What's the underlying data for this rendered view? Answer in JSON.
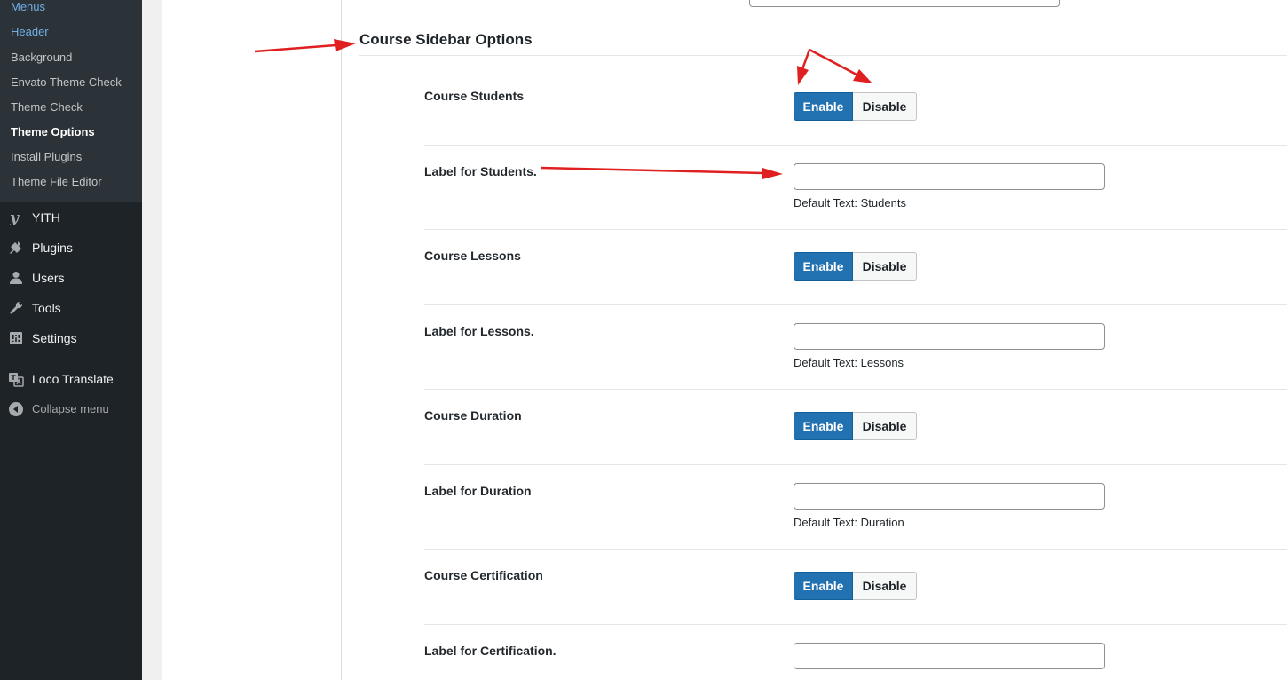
{
  "sidebar": {
    "submenu": [
      {
        "label": "Menus"
      },
      {
        "label": "Header"
      },
      {
        "label": "Background"
      },
      {
        "label": "Envato Theme Check"
      },
      {
        "label": "Theme Check"
      },
      {
        "label": "Theme Options"
      },
      {
        "label": "Install Plugins"
      },
      {
        "label": "Theme File Editor"
      }
    ],
    "menu": [
      {
        "label": "YITH",
        "icon": "yith-icon"
      },
      {
        "label": "Plugins",
        "icon": "plugins-icon"
      },
      {
        "label": "Users",
        "icon": "users-icon"
      },
      {
        "label": "Tools",
        "icon": "tools-icon"
      },
      {
        "label": "Settings",
        "icon": "settings-icon"
      },
      {
        "label": "Loco Translate",
        "icon": "translate-icon"
      },
      {
        "label": "Collapse menu",
        "icon": "collapse-icon"
      }
    ]
  },
  "section": {
    "title": "Course Sidebar Options"
  },
  "rows": [
    {
      "label": "Course Students",
      "type": "toggle",
      "on": "Enable",
      "off": "Disable"
    },
    {
      "label": "Label for Students.",
      "type": "text",
      "value": "",
      "help": "Default Text: Students"
    },
    {
      "label": "Course Lessons",
      "type": "toggle",
      "on": "Enable",
      "off": "Disable"
    },
    {
      "label": "Label for Lessons.",
      "type": "text",
      "value": "",
      "help": "Default Text: Lessons"
    },
    {
      "label": "Course Duration",
      "type": "toggle",
      "on": "Enable",
      "off": "Disable"
    },
    {
      "label": "Label for Duration",
      "type": "text",
      "value": "",
      "help": "Default Text: Duration"
    },
    {
      "label": "Course Certification",
      "type": "toggle",
      "on": "Enable",
      "off": "Disable"
    },
    {
      "label": "Label for Certification.",
      "type": "text",
      "value": ""
    }
  ],
  "colors": {
    "sidebar_bg": "#1d2327",
    "submenu_bg": "#2c3338",
    "accent": "#2271b1",
    "annotation": "#e02020"
  }
}
